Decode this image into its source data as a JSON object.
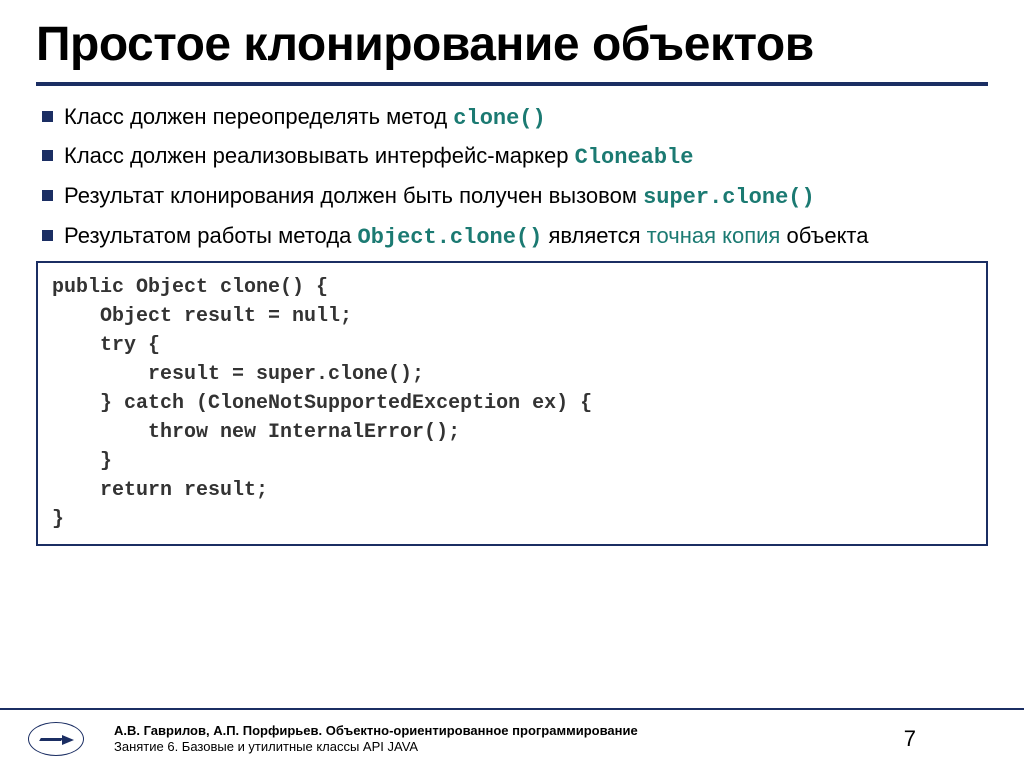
{
  "title": "Простое клонирование объектов",
  "bullets": [
    {
      "pre": "Класс должен переопределять метод ",
      "code": "clone()",
      "post": ""
    },
    {
      "pre": "Класс должен реализовывать интерфейс-маркер ",
      "code": "Cloneable",
      "post": ""
    },
    {
      "pre": "Результат клонирования должен быть получен вызовом ",
      "code": "super.clone()",
      "post": ""
    },
    {
      "pre": "Результатом работы метода ",
      "code": "Object.clone()",
      "post": " является ",
      "accent": "точная копия",
      "tail": " объекта"
    }
  ],
  "code": "public Object clone() {\n    Object result = null;\n    try {\n        result = super.clone();\n    } catch (CloneNotSupportedException ex) {\n        throw new InternalError();\n    }\n    return result;\n}",
  "footer": {
    "authors": "А.В. Гаврилов, А.П. Порфирьев. Объектно-ориентированное программирование",
    "lesson": "Занятие 6. Базовые и утилитные классы API JAVA",
    "page": "7"
  }
}
